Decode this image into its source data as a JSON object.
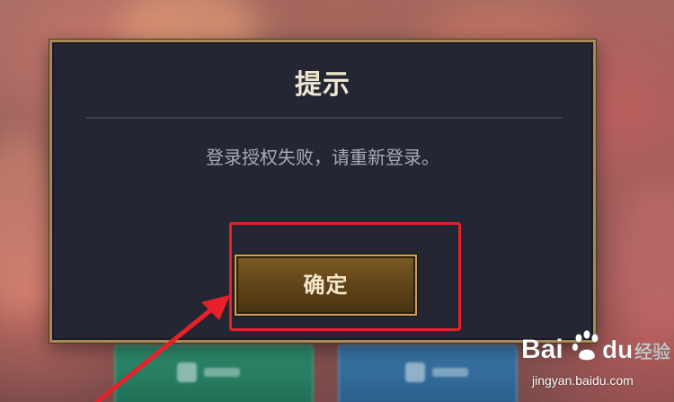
{
  "dialog": {
    "title": "提示",
    "message": "登录授权失败，请重新登录。",
    "confirm_label": "确定"
  },
  "watermark": {
    "brand": "Bai du 经验",
    "url": "jingyan.baidu.com"
  },
  "colors": {
    "dialog_bg": "#242633",
    "dialog_border": "#a78a58",
    "button_gold": "#c9a55c",
    "annotation_red": "#e8202a"
  }
}
